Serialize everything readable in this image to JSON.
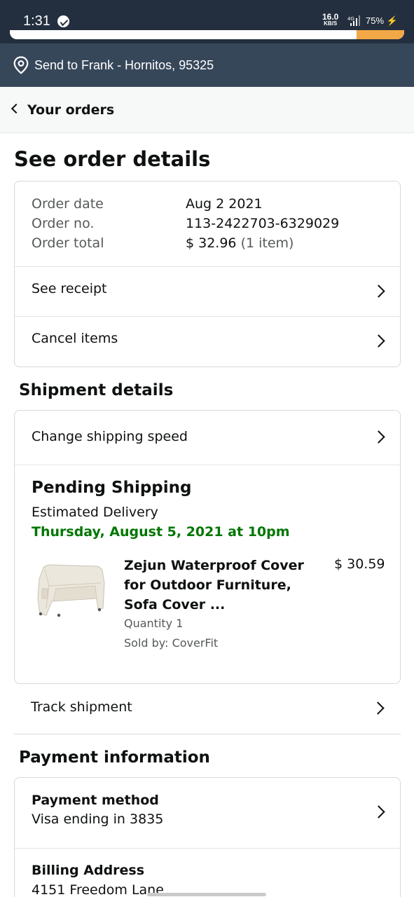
{
  "status_bar": {
    "time": "1:31",
    "net_speed_value": "16.0",
    "net_speed_unit": "KB/S",
    "network": "4G",
    "battery": "75%"
  },
  "location": {
    "text": "Send to Frank - Hornitos, 95325"
  },
  "breadcrumb": {
    "label": "Your orders"
  },
  "page": {
    "title": "See order details"
  },
  "order_summary": {
    "date_label": "Order date",
    "date_value": "Aug 2 2021",
    "number_label": "Order no.",
    "number_value": "113-2422703-6329029",
    "total_label": "Order total",
    "total_value": "$ 32.96",
    "total_items": "(1 item)",
    "see_receipt": "See receipt",
    "cancel_items": "Cancel items"
  },
  "shipment": {
    "section_title": "Shipment details",
    "change_speed": "Change shipping speed",
    "status": "Pending Shipping",
    "estimated_label": "Estimated Delivery",
    "estimated_date": "Thursday, August 5, 2021 at 10pm",
    "item": {
      "title": "Zejun Waterproof Cover for Outdoor Furniture, Sofa Cover ...",
      "price": "$ 30.59",
      "quantity": "Quantity 1",
      "seller": "Sold by: CoverFit",
      "image_icon": "sofa-cover-image"
    },
    "track": "Track shipment"
  },
  "payment": {
    "section_title": "Payment information",
    "method_title": "Payment method",
    "method_value": "Visa ending in 3835",
    "billing_title": "Billing Address",
    "billing_value": "4151 Freedom Lane"
  },
  "colors": {
    "header_dark": "#232f3e",
    "location_bar": "#37475a",
    "accent": "#f3a847",
    "delivery_green": "#007600"
  }
}
